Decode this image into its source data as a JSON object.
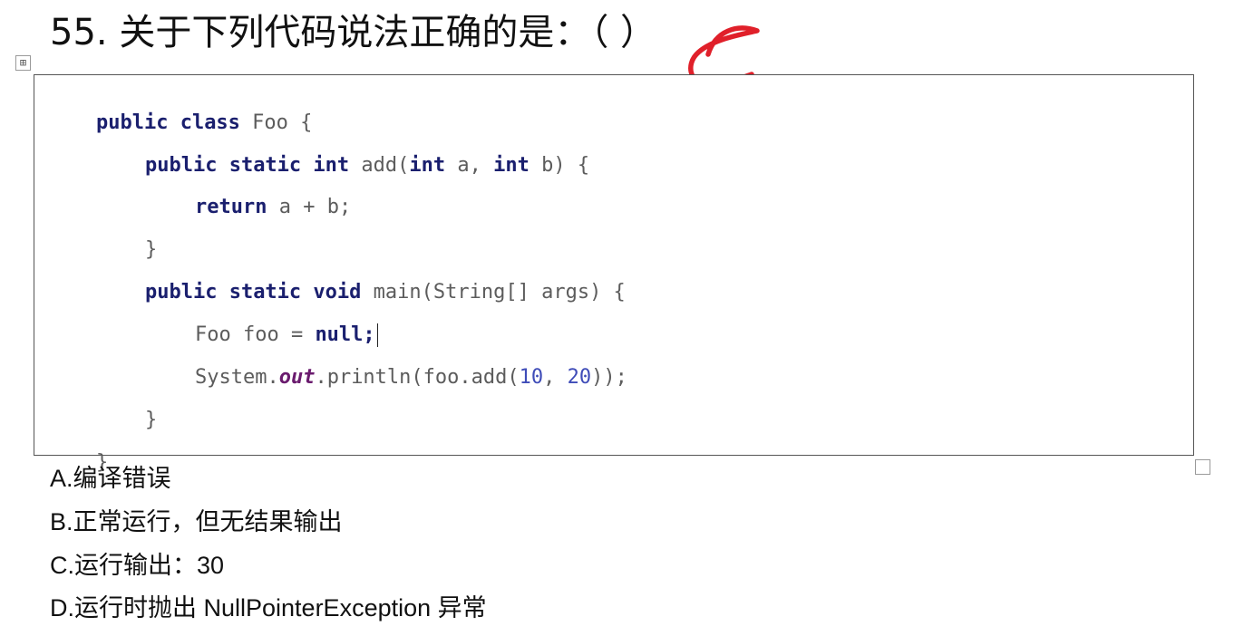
{
  "question": {
    "number": "55.",
    "stem": "关于下列代码说法正确的是：（ ）",
    "handwritten_answer": "C"
  },
  "table_handle_glyph": "⊞",
  "code": {
    "l1": {
      "k1": "public class",
      "t1": " Foo {"
    },
    "l2": {
      "k1": "public static int",
      "t1": " add(",
      "k2": "int",
      "t2": " a, ",
      "k3": "int",
      "t3": " b) {"
    },
    "l3": {
      "k1": "return",
      "t1": " a + b;"
    },
    "l4": {
      "t1": "}"
    },
    "l5": {
      "k1": "public static void",
      "t1": " main(String[] args) {"
    },
    "l6": {
      "t1": "Foo foo = ",
      "k1": "null",
      "t2": ";"
    },
    "l7": {
      "t1": "System.",
      "f1": "out",
      "t2": ".println(foo.add(",
      "n1": "10",
      "t3": ", ",
      "n2": "20",
      "t4": "));"
    },
    "l8": {
      "t1": "}"
    },
    "l9": {
      "t1": "}"
    }
  },
  "options": {
    "a": "A.编译错误",
    "b": "B.正常运行，但无结果输出",
    "c": "C.运行输出：30",
    "d": "D.运行时抛出 NullPointerException 异常"
  },
  "colors": {
    "keyword": "#1a1f6e",
    "field": "#6a1b6e",
    "number": "#3f4cb8",
    "plain_code": "#5c5c5c",
    "handwriting": "#e0202a"
  }
}
